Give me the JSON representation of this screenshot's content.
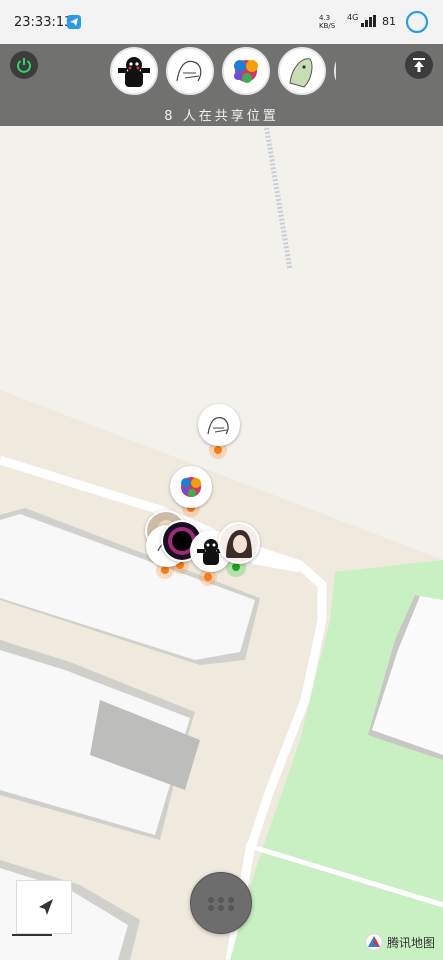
{
  "status_bar": {
    "time": "23:33:13",
    "network_speed": "4.3 KB/S",
    "signal_label": "4G",
    "battery": "81"
  },
  "share_header": {
    "power_icon": "power-icon",
    "top_icon": "scroll-to-top-icon",
    "avatars": [
      "kumamon-avatar",
      "sketch-avatar",
      "color-splash-avatar",
      "fish-avatar"
    ],
    "sharing_text": "8 人在共享位置"
  },
  "map": {
    "markers": [
      "sketch-marker",
      "color-splash-marker",
      "portrait-marker",
      "black-hole-marker",
      "kumamon-marker",
      "anime-girl-marker"
    ],
    "compass_icon": "location-arrow-icon",
    "provider_logo_text": "腾讯地图",
    "colors": {
      "land": "#f2f1ec",
      "road": "#ffffff",
      "building": "#f7f7f7",
      "park": "#c8f0c3",
      "header": "#696969"
    }
  },
  "menu_button_icon": "grid-menu-icon"
}
